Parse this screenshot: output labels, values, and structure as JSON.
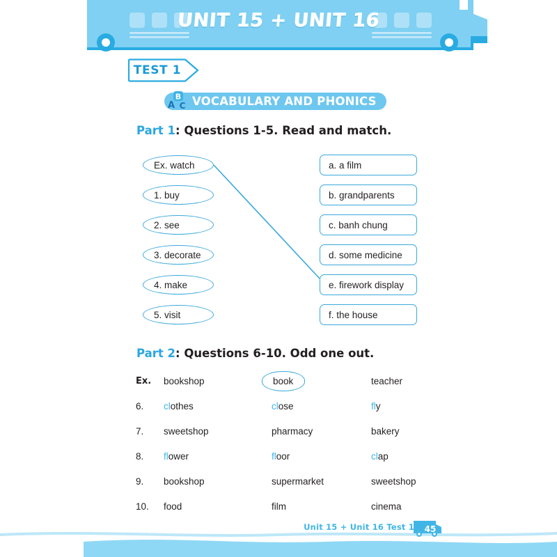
{
  "header": {
    "title": "UNIT 15 + UNIT 16",
    "bus_icon": "school-bus-icon"
  },
  "test_badge": {
    "label": "TEST 1"
  },
  "section": {
    "icon": "abc-blocks-icon",
    "letters": {
      "a": "A",
      "b": "B",
      "c": "C"
    },
    "title": "VOCABULARY AND PHONICS"
  },
  "part1": {
    "part_word": "Part 1",
    "heading_rest": ": Questions 1-5. Read and match.",
    "left_items": [
      {
        "label": "Ex. watch"
      },
      {
        "label": "1. buy"
      },
      {
        "label": "2. see"
      },
      {
        "label": "3. decorate"
      },
      {
        "label": "4. make"
      },
      {
        "label": "5. visit"
      }
    ],
    "right_items": [
      {
        "label": "a. a film"
      },
      {
        "label": "b. grandparents"
      },
      {
        "label": "c. banh chung"
      },
      {
        "label": "d. some medicine"
      },
      {
        "label": "e. firework display"
      },
      {
        "label": "f. the house"
      }
    ],
    "connection": {
      "from": "Ex. watch",
      "to": "e. firework display"
    }
  },
  "part2": {
    "part_word": "Part 2",
    "heading_rest": ": Questions 6-10. Odd one out.",
    "rows": [
      {
        "num": "Ex.",
        "num_bold": true,
        "c1": {
          "hl": "",
          "rest": "bookshop"
        },
        "c2": {
          "hl": "",
          "rest": "book",
          "circled": true
        },
        "c3": {
          "hl": "",
          "rest": "teacher"
        }
      },
      {
        "num": "6.",
        "num_bold": false,
        "c1": {
          "hl": "cl",
          "rest": "othes"
        },
        "c2": {
          "hl": "cl",
          "rest": "ose"
        },
        "c3": {
          "hl": "fl",
          "rest": "y"
        }
      },
      {
        "num": "7.",
        "num_bold": false,
        "c1": {
          "hl": "",
          "rest": "sweetshop"
        },
        "c2": {
          "hl": "",
          "rest": "pharmacy"
        },
        "c3": {
          "hl": "",
          "rest": "bakery"
        }
      },
      {
        "num": "8.",
        "num_bold": false,
        "c1": {
          "hl": "fl",
          "rest": "ower"
        },
        "c2": {
          "hl": "fl",
          "rest": "oor"
        },
        "c3": {
          "hl": "cl",
          "rest": "ap"
        }
      },
      {
        "num": "9.",
        "num_bold": false,
        "c1": {
          "hl": "",
          "rest": "bookshop"
        },
        "c2": {
          "hl": "",
          "rest": "supermarket"
        },
        "c3": {
          "hl": "",
          "rest": "sweetshop"
        }
      },
      {
        "num": "10.",
        "num_bold": false,
        "c1": {
          "hl": "",
          "rest": "food"
        },
        "c2": {
          "hl": "",
          "rest": "film"
        },
        "c3": {
          "hl": "",
          "rest": "cinema"
        }
      }
    ]
  },
  "footer": {
    "label": "Unit 15 + Unit 16 Test 1",
    "page_number": "45",
    "bus_icon": "mini-bus-icon"
  },
  "colors": {
    "bus_body": "#7fd0f2",
    "bus_accent": "#29abe2",
    "banner_blue": "#6dc7ef",
    "outline_blue": "#3aa8da",
    "accent_text": "#2ba6e0",
    "highlight": "#3fb3e8",
    "footer_wave": "#8fd8f5",
    "text": "#231f20"
  }
}
